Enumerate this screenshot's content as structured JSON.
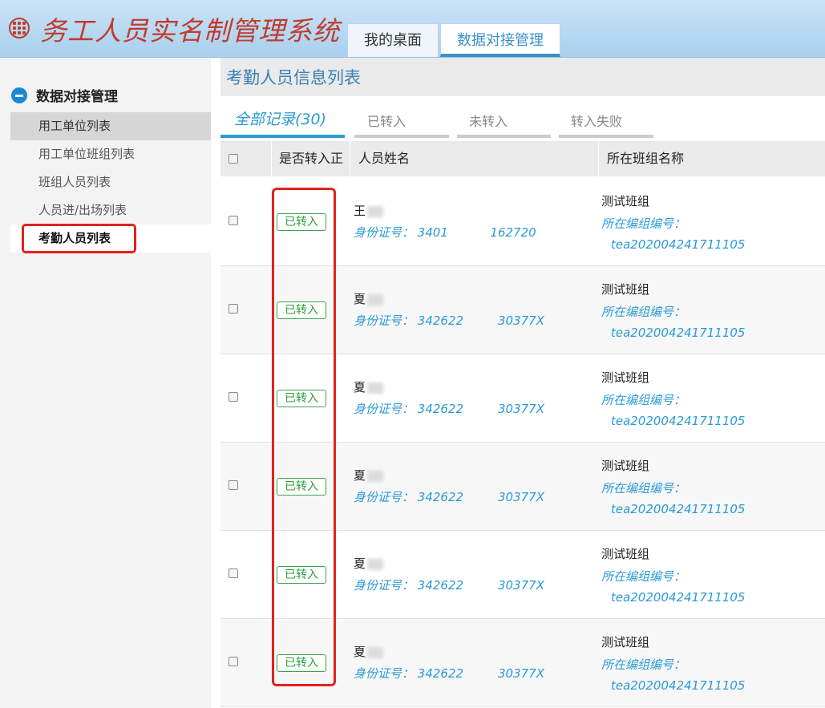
{
  "app": {
    "title": "务工人员实名制管理系统"
  },
  "top_nav": {
    "tabs": [
      {
        "label": "我的桌面",
        "active": false
      },
      {
        "label": "数据对接管理",
        "active": true
      }
    ]
  },
  "sidebar": {
    "section_title": "数据对接管理",
    "items": [
      {
        "label": "用工单位列表"
      },
      {
        "label": "用工单位班组列表"
      },
      {
        "label": "班组人员列表"
      },
      {
        "label": "人员进/出场列表"
      },
      {
        "label": "考勤人员列表"
      }
    ]
  },
  "main": {
    "page_title": "考勤人员信息列表",
    "subtabs": [
      {
        "label": "全部记录(30)",
        "active": true
      },
      {
        "label": "已转入",
        "active": false
      },
      {
        "label": "未转入",
        "active": false
      },
      {
        "label": "转入失败",
        "active": false
      }
    ],
    "columns": [
      "是否转入正",
      "人员姓名",
      "所在班组名称"
    ],
    "rows": [
      {
        "status": "已转入",
        "name": "王",
        "id_label": "身份证号：",
        "id_value": "3401           162720",
        "team": "测试班组",
        "team_code_label": "所在编组编号：",
        "team_code": "tea202004241711105"
      },
      {
        "status": "已转入",
        "name": "夏",
        "id_label": "身份证号：",
        "id_value": "342622         30377X",
        "team": "测试班组",
        "team_code_label": "所在编组编号：",
        "team_code": "tea202004241711105"
      },
      {
        "status": "已转入",
        "name": "夏",
        "id_label": "身份证号：",
        "id_value": "342622         30377X",
        "team": "测试班组",
        "team_code_label": "所在编组编号：",
        "team_code": "tea202004241711105"
      },
      {
        "status": "已转入",
        "name": "夏",
        "id_label": "身份证号：",
        "id_value": "342622         30377X",
        "team": "测试班组",
        "team_code_label": "所在编组编号：",
        "team_code": "tea202004241711105"
      },
      {
        "status": "已转入",
        "name": "夏",
        "id_label": "身份证号：",
        "id_value": "342622         30377X",
        "team": "测试班组",
        "team_code_label": "所在编组编号：",
        "team_code": "tea202004241711105"
      },
      {
        "status": "已转入",
        "name": "夏",
        "id_label": "身份证号：",
        "id_value": "342622         30377X",
        "team": "测试班组",
        "team_code_label": "所在编组编号：",
        "team_code": "tea202004241711105"
      }
    ]
  },
  "colors": {
    "accent": "#2a9ad6",
    "title_red": "#c23b2d",
    "annotation_red": "#e0231d",
    "status_green": "#2e9e40"
  },
  "icons": {
    "logo": "grid-menu-icon",
    "collapse": "minus-circle-icon"
  }
}
